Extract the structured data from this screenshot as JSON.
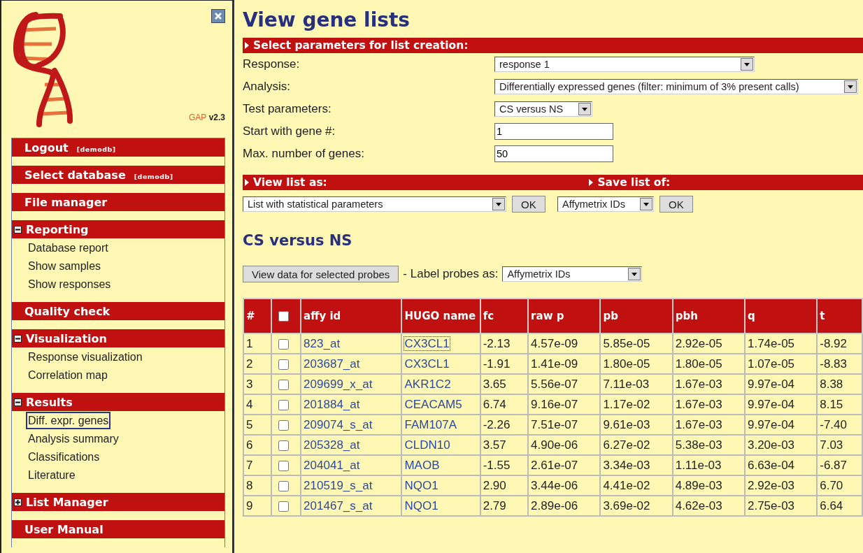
{
  "sidebar": {
    "version_brand": "GAP",
    "version": "v2.3",
    "sections": [
      {
        "kind": "link",
        "title": "Logout",
        "note": "[demodb]"
      },
      {
        "kind": "link",
        "title": "Select database",
        "note": "[demodb]"
      },
      {
        "kind": "link",
        "title": "File manager"
      },
      {
        "kind": "group",
        "title": "Reporting",
        "expanded": true,
        "items": [
          {
            "label": "Database report",
            "selected": false
          },
          {
            "label": "Show samples",
            "selected": false
          },
          {
            "label": "Show responses",
            "selected": false
          }
        ]
      },
      {
        "kind": "link",
        "title": "Quality check"
      },
      {
        "kind": "group",
        "title": "Visualization",
        "expanded": true,
        "items": [
          {
            "label": "Response visualization",
            "selected": false
          },
          {
            "label": "Correlation map",
            "selected": false
          }
        ]
      },
      {
        "kind": "group",
        "title": "Results",
        "expanded": true,
        "items": [
          {
            "label": "Diff. expr. genes",
            "selected": true
          },
          {
            "label": "Analysis summary",
            "selected": false
          },
          {
            "label": "Classifications",
            "selected": false
          },
          {
            "label": "Literature",
            "selected": false
          }
        ]
      },
      {
        "kind": "group",
        "title": "List Manager",
        "expanded": false
      },
      {
        "kind": "link",
        "title": "User Manual"
      }
    ]
  },
  "page_title": "View gene lists",
  "parameters": {
    "title": "Select parameters for list creation:",
    "fields": [
      {
        "kind": "select",
        "label": "Response:",
        "value": "response 1"
      },
      {
        "kind": "select",
        "label": "Analysis:",
        "value": "Differentially expressed genes (filter: minimum of 3% present calls)"
      },
      {
        "kind": "select",
        "label": "Test parameters:",
        "value": "CS versus NS"
      },
      {
        "kind": "input",
        "label": "Start with gene #:",
        "value": "1"
      },
      {
        "kind": "input",
        "label": "Max. number of genes:",
        "value": "50"
      }
    ]
  },
  "view_list": {
    "title": "View list as:",
    "value": "List with statistical parameters",
    "button": "OK"
  },
  "save_list": {
    "title": "Save list of:",
    "value": "Affymetrix IDs",
    "button": "OK"
  },
  "result_title": "CS versus NS",
  "view_button": "View data for selected probes",
  "label_probes": {
    "label": "- Label probes as:",
    "value": "Affymetrix IDs"
  },
  "table": {
    "columns": [
      "#",
      "affy id",
      "HUGO name",
      "fc",
      "raw p",
      "pb",
      "pbh",
      "q",
      "t"
    ],
    "select_all_checked": false,
    "rows": [
      {
        "n": "1",
        "checked": false,
        "affy": "823_at",
        "hugo": "CX3CL1",
        "focused": true,
        "fc": "-2.13",
        "raw_p": "4.57e-09",
        "pb": "5.85e-05",
        "pbh": "2.92e-05",
        "q": "1.74e-05",
        "t": "-8.92"
      },
      {
        "n": "2",
        "checked": false,
        "affy": "203687_at",
        "hugo": "CX3CL1",
        "focused": false,
        "fc": "-1.91",
        "raw_p": "1.41e-09",
        "pb": "1.80e-05",
        "pbh": "1.80e-05",
        "q": "1.07e-05",
        "t": "-8.83"
      },
      {
        "n": "3",
        "checked": false,
        "affy": "209699_x_at",
        "hugo": "AKR1C2",
        "focused": false,
        "fc": "3.65",
        "raw_p": "5.56e-07",
        "pb": "7.11e-03",
        "pbh": "1.67e-03",
        "q": "9.97e-04",
        "t": "8.38"
      },
      {
        "n": "4",
        "checked": false,
        "affy": "201884_at",
        "hugo": "CEACAM5",
        "focused": false,
        "fc": "6.74",
        "raw_p": "9.16e-07",
        "pb": "1.17e-02",
        "pbh": "1.67e-03",
        "q": "9.97e-04",
        "t": "8.15"
      },
      {
        "n": "5",
        "checked": false,
        "affy": "209074_s_at",
        "hugo": "FAM107A",
        "focused": false,
        "fc": "-2.26",
        "raw_p": "7.51e-07",
        "pb": "9.61e-03",
        "pbh": "1.67e-03",
        "q": "9.97e-04",
        "t": "-7.40"
      },
      {
        "n": "6",
        "checked": false,
        "affy": "205328_at",
        "hugo": "CLDN10",
        "focused": false,
        "fc": "3.57",
        "raw_p": "4.90e-06",
        "pb": "6.27e-02",
        "pbh": "5.38e-03",
        "q": "3.20e-03",
        "t": "7.03"
      },
      {
        "n": "7",
        "checked": false,
        "affy": "204041_at",
        "hugo": "MAOB",
        "focused": false,
        "fc": "-1.55",
        "raw_p": "2.61e-07",
        "pb": "3.34e-03",
        "pbh": "1.11e-03",
        "q": "6.63e-04",
        "t": "-6.87"
      },
      {
        "n": "8",
        "checked": false,
        "affy": "210519_s_at",
        "hugo": "NQO1",
        "focused": false,
        "fc": "2.90",
        "raw_p": "3.44e-06",
        "pb": "4.41e-02",
        "pbh": "4.89e-03",
        "q": "2.92e-03",
        "t": "6.70"
      },
      {
        "n": "9",
        "checked": false,
        "affy": "201467_s_at",
        "hugo": "NQO1",
        "focused": false,
        "fc": "2.79",
        "raw_p": "2.89e-06",
        "pb": "3.69e-02",
        "pbh": "4.62e-03",
        "q": "2.75e-03",
        "t": "6.64"
      }
    ]
  }
}
